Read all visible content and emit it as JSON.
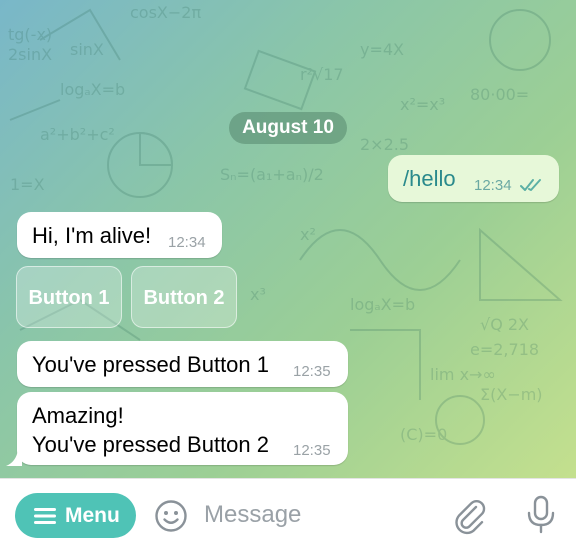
{
  "date_separator": "August 10",
  "messages": [
    {
      "direction": "out",
      "text": "/hello",
      "time": "12:34",
      "status": "read-double-check"
    },
    {
      "direction": "in",
      "text": "Hi, I'm alive!",
      "time": "12:34"
    },
    {
      "direction": "in",
      "text": "You've pressed Button 1",
      "time": "12:35"
    },
    {
      "direction": "in",
      "line1": "Amazing!",
      "line2": "You've pressed Button 2",
      "time": "12:35"
    }
  ],
  "inline_keyboard": [
    {
      "label": "Button 1"
    },
    {
      "label": "Button 2"
    }
  ],
  "composer": {
    "menu_label": "Menu",
    "placeholder": "Message",
    "icons": [
      "menu-icon",
      "emoji-icon",
      "attach-icon",
      "mic-icon"
    ]
  },
  "colors": {
    "accent": "#4fc3b6",
    "outgoing_bubble": "#e7f8d9",
    "incoming_bubble": "#ffffff"
  }
}
